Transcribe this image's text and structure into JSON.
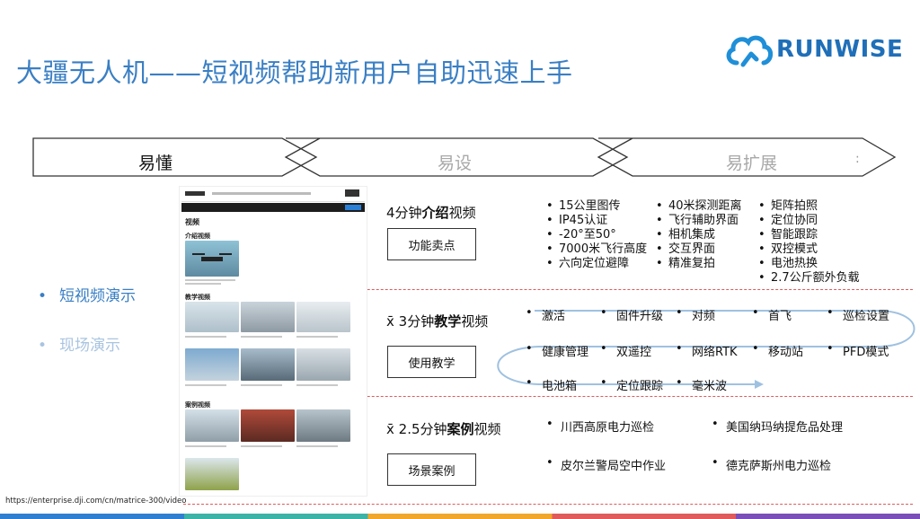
{
  "slide": {
    "title": "大疆无人机——短视频帮助新用户自助迅速上手",
    "logo_text": "RUNWISE",
    "brand_color": "#1f6fb8",
    "title_color": "#3a7fc4"
  },
  "stages": [
    {
      "label": "易懂",
      "active": true
    },
    {
      "label": "易设",
      "active": false
    },
    {
      "label": "易扩展",
      "active": false
    }
  ],
  "sidebar": {
    "items": [
      {
        "label": "短视频演示",
        "active": true
      },
      {
        "label": "现场演示",
        "active": false
      }
    ]
  },
  "screenshot": {
    "section_videos": "视频",
    "section_intro": "介绍视频",
    "section_teach": "教学视频",
    "section_case": "案例视频"
  },
  "rows": {
    "intro": {
      "title_pre": "4分钟",
      "title_bold": "介绍",
      "title_post": "视频",
      "box": "功能卖点",
      "col1": [
        "15公里图传",
        "IP45认证",
        "-20°至50°",
        "7000米飞行高度",
        "六向定位避障"
      ],
      "col2": [
        "40米探测距离",
        "飞行辅助界面",
        "相机集成",
        "交互界面",
        "精准复拍"
      ],
      "col3": [
        "矩阵拍照",
        "定位协同",
        "智能跟踪",
        "双控模式",
        "电池热换",
        "2.7公斤额外负载"
      ]
    },
    "teach": {
      "title_pre": "x̄ 3分钟",
      "title_bold": "教学",
      "title_post": "视频",
      "box": "使用教学",
      "items": [
        "激活",
        "固件升级",
        "对频",
        "首飞",
        "巡检设置",
        "健康管理",
        "双遥控",
        "网络RTK",
        "移动站",
        "PFD模式",
        "电池箱",
        "定位跟踪",
        "毫米波"
      ]
    },
    "cases": {
      "title_pre": "x̄ 2.5分钟",
      "title_bold": "案例",
      "title_post": "视频",
      "box": "场景案例",
      "items": [
        "川西高原电力巡检",
        "美国纳玛纳提危品处理",
        "皮尔兰警局空中作业",
        "德克萨斯州电力巡检"
      ]
    }
  },
  "footer": {
    "url": "https://enterprise.dji.com/cn/matrice-300/video"
  }
}
